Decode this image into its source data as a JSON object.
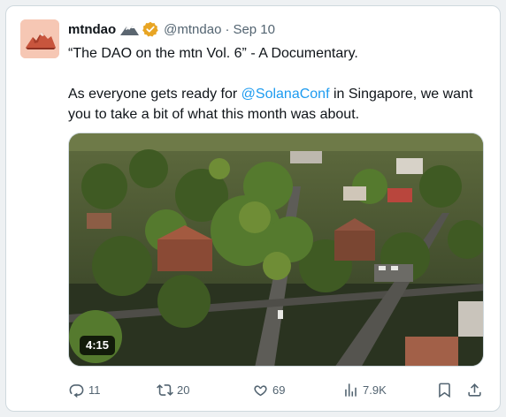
{
  "post": {
    "author_name": "mtndao",
    "handle": "@mtndao",
    "separator": "·",
    "date": "Sep 10",
    "badge_icon": "verified-gold-badge",
    "name_emoji_icon": "snowcapped-mountain",
    "text": {
      "line1": "“The DAO on the mtn Vol. 6” - A Documentary.",
      "p2_before": "As everyone gets ready for ",
      "mention": "@SolanaConf",
      "p2_after": " in Singapore, we want you to take a bit of what this month was about."
    },
    "video": {
      "duration": "4:15",
      "thumbnail_icon": "aerial-town-video-thumbnail"
    }
  },
  "actions": {
    "replies": "11",
    "reposts": "20",
    "likes": "69",
    "views": "7.9K"
  },
  "colors": {
    "link": "#1d9bf0",
    "secondary_text": "#536471",
    "verified_gold": "#e8a524",
    "avatar_bg": "#f6c7b4"
  }
}
